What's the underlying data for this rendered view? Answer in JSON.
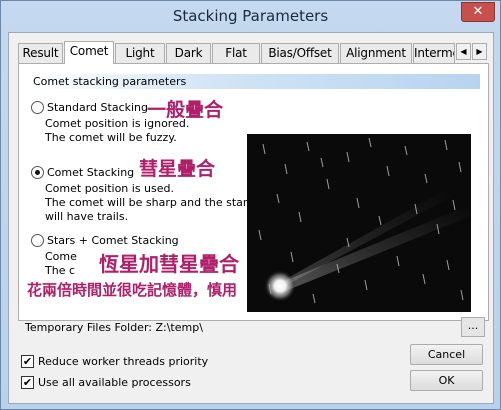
{
  "window": {
    "title": "Stacking Parameters",
    "close_glyph": "✕"
  },
  "tabs": [
    {
      "label": "Result"
    },
    {
      "label": "Comet"
    },
    {
      "label": "Light"
    },
    {
      "label": "Dark"
    },
    {
      "label": "Flat"
    },
    {
      "label": "Bias/Offset"
    },
    {
      "label": "Alignment"
    },
    {
      "label": "Interme"
    }
  ],
  "tab_scroll": {
    "left": "◀",
    "right": "▶"
  },
  "comet": {
    "section_title": "Comet stacking parameters",
    "options": [
      {
        "label": "Standard Stacking",
        "checked": false,
        "desc": [
          "Comet position is ignored.",
          "The comet will be fuzzy."
        ]
      },
      {
        "label": "Comet Stacking",
        "checked": true,
        "desc": [
          "Comet position is used.",
          "The comet will be sharp and the stars",
          "will have trails."
        ]
      },
      {
        "label": "Stars + Comet Stacking",
        "checked": false,
        "desc": [
          "Come",
          "The c"
        ]
      }
    ],
    "annotations": {
      "standard": "一般疊合",
      "comet": "彗星疊合",
      "stars_comet": "恆星加彗星疊合",
      "note": "花兩倍時間並很吃記憶體，慎用"
    }
  },
  "temp_folder": {
    "label": "Temporary Files Folder:  Z:\\temp\\",
    "browse_label": "..."
  },
  "checkboxes": [
    {
      "label": "Reduce worker threads priority",
      "checked": true
    },
    {
      "label": "Use all available processors",
      "checked": true
    }
  ],
  "buttons": {
    "cancel": "Cancel",
    "ok": "OK"
  },
  "colors": {
    "annotation": "#b0206a",
    "accent": "#b8d3ef"
  },
  "icons": {
    "check": "✔"
  }
}
